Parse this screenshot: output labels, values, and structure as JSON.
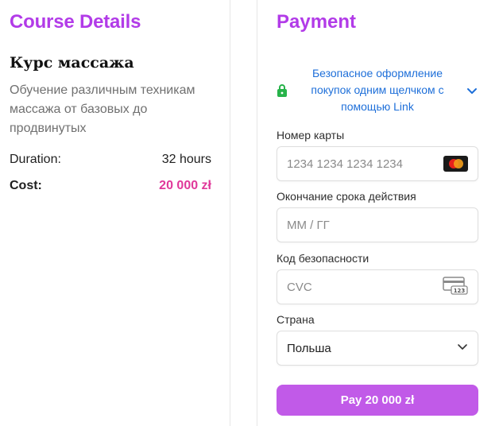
{
  "course": {
    "section_title": "Course Details",
    "name": "Курс массажа",
    "description": "Обучение различным техникам массажа от базовых до продвинутых",
    "duration_label": "Duration:",
    "duration_value": "32 hours",
    "cost_label": "Cost:",
    "cost_value": "20 000 zł"
  },
  "payment": {
    "section_title": "Payment",
    "link_text": "Безопасное оформление покупок одним щелчком с помощью Link",
    "card_number_label": "Номер карты",
    "card_number_placeholder": "1234 1234 1234 1234",
    "expiry_label": "Окончание срока действия",
    "expiry_placeholder": "ММ / ГГ",
    "cvc_label": "Код безопасности",
    "cvc_placeholder": "CVC",
    "cvc_icon_text": "123",
    "country_label": "Страна",
    "country_value": "Польша",
    "pay_button": "Pay 20 000 zł"
  },
  "icons": {
    "lock": "lock-icon",
    "link_chevron": "chevron-down-icon",
    "card_brand": "mastercard-icon",
    "cvc": "card-cvc-icon",
    "select_chevron": "chevron-down-icon"
  },
  "colors": {
    "accent": "#b23be8",
    "price": "#e0389a",
    "link": "#1e6fd9",
    "lock": "#27b34a",
    "button": "#c15ae8"
  }
}
